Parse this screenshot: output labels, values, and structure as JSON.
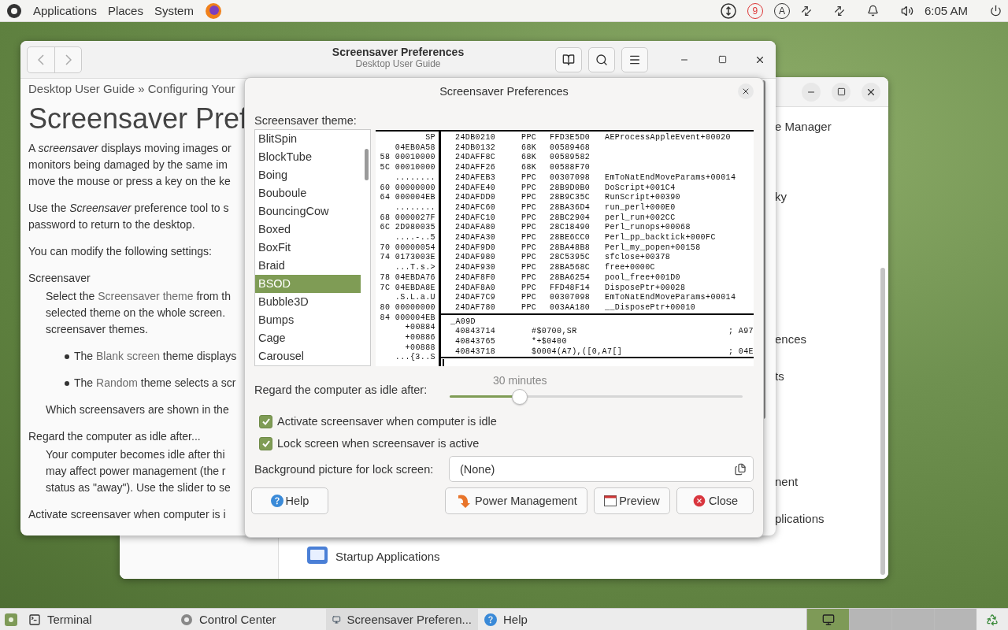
{
  "top_panel": {
    "menus": [
      "Applications",
      "Places",
      "System"
    ],
    "indicator_letter": "A",
    "badge": "9",
    "clock": "6:05 AM"
  },
  "control_center": {
    "sections": [
      [
        "e Manager"
      ],
      [
        "ky"
      ],
      [
        "ences",
        "ts"
      ],
      [
        "nent",
        "plications"
      ]
    ],
    "startup_item": "Startup Applications"
  },
  "help_window": {
    "title": "Screensaver Preferences",
    "subtitle": "Desktop User Guide",
    "breadcrumb": "Desktop User Guide » Configuring Your",
    "heading": "Screensaver Pref",
    "blocks": [
      {
        "kind": "para",
        "lines": [
          [
            {
              "text": "A *screensaver* displays moving images or"
            }
          ],
          [
            {
              "text": "monitors being damaged by the same im"
            }
          ],
          [
            {
              "text": "move the mouse or press a key on the ke"
            }
          ]
        ]
      },
      {
        "kind": "para",
        "lines": [
          [
            {
              "text": "Use the *Screensaver* preference tool to s"
            }
          ],
          [
            {
              "text": "password to return to the desktop."
            }
          ]
        ]
      },
      {
        "kind": "para",
        "lines": [
          [
            {
              "text": "You can modify the following settings:"
            }
          ]
        ]
      },
      {
        "kind": "term",
        "lines": [
          [
            {
              "text": "Screensaver"
            }
          ]
        ]
      },
      {
        "kind": "def",
        "lines": [
          [
            {
              "text": "Select the "
            },
            {
              "text": "Screensaver theme",
              "kind": "link"
            },
            {
              "text": " from th"
            }
          ],
          [
            {
              "text": "selected theme on the whole screen."
            }
          ],
          [
            {
              "text": "screensaver themes."
            }
          ]
        ]
      },
      {
        "kind": "bullet",
        "lines": [
          [
            {
              "text": "The "
            },
            {
              "text": "Blank screen",
              "kind": "link"
            },
            {
              "text": " theme displays"
            }
          ]
        ]
      },
      {
        "kind": "bullet",
        "lines": [
          [
            {
              "text": "The "
            },
            {
              "text": "Random",
              "kind": "link"
            },
            {
              "text": " theme selects a scr"
            }
          ]
        ]
      },
      {
        "kind": "def",
        "lines": [
          [
            {
              "text": "Which screensavers are shown in the"
            }
          ]
        ]
      },
      {
        "kind": "term",
        "lines": [
          [
            {
              "text": "Regard the computer as idle after..."
            }
          ]
        ]
      },
      {
        "kind": "def",
        "lines": [
          [
            {
              "text": "Your computer becomes idle after thi"
            }
          ],
          [
            {
              "text": "may affect power management (the r"
            }
          ],
          [
            {
              "text": "status as \"away\"). Use the slider to se"
            }
          ]
        ]
      },
      {
        "kind": "term",
        "lines": [
          [
            {
              "text": "Activate screensaver when computer is i"
            }
          ]
        ]
      }
    ]
  },
  "dialog": {
    "title": "Screensaver Preferences",
    "theme_label": "Screensaver theme:",
    "themes": [
      {
        "label": "BlitSpin",
        "selected": false
      },
      {
        "label": "BlockTube",
        "selected": false
      },
      {
        "label": "Boing",
        "selected": false
      },
      {
        "label": "Bouboule",
        "selected": false
      },
      {
        "label": "BouncingCow",
        "selected": false
      },
      {
        "label": "Boxed",
        "selected": false
      },
      {
        "label": "BoxFit",
        "selected": false
      },
      {
        "label": "Braid",
        "selected": false
      },
      {
        "label": "BSOD",
        "selected": true
      },
      {
        "label": "Bubble3D",
        "selected": false
      },
      {
        "label": "Bumps",
        "selected": false
      },
      {
        "label": "Cage",
        "selected": false
      },
      {
        "label": "Carousel",
        "selected": false
      }
    ],
    "preview": {
      "stack_lines": [
        "SP",
        "04EB0A58",
        "58 00010000",
        "5C 00010000",
        "........",
        "60 00000000",
        "64 000004EB",
        "........",
        "68 0000027F",
        "6C 2D980035",
        "....-..5",
        "70 00000054",
        "74 0173003E",
        "...T.s.>",
        "78 04EBDA76",
        "7C 04EBDA8E",
        ".S.L.a.U",
        "80 00000000",
        "84 000004EB",
        "+00884",
        "+00886",
        "+00888",
        "...{3..S"
      ],
      "trace_rows": [
        [
          "24DB0210",
          "PPC",
          "FFD3E5D0",
          "AEProcessAppleEvent+00020"
        ],
        [
          "24DB0132",
          "68K",
          "00589468"
        ],
        [
          "24DAFF8C",
          "68K",
          "00589582"
        ],
        [
          "24DAFF26",
          "68K",
          "00588F70"
        ],
        [
          "24DAFEB3",
          "PPC",
          "00307098",
          "EmToNatEndMoveParams+00014"
        ],
        [
          "24DAFE40",
          "PPC",
          "28B9D0B0",
          "DoScript+001C4"
        ],
        [
          "24DAFDD0",
          "PPC",
          "28B9C35C",
          "RunScript+00390"
        ],
        [
          "24DAFC60",
          "PPC",
          "28BA36D4",
          "run_perl+000E0"
        ],
        [
          "24DAFC10",
          "PPC",
          "28BC2904",
          "perl_run+002CC"
        ],
        [
          "24DAFA80",
          "PPC",
          "28C18490",
          "Perl_runops+00068"
        ],
        [
          "24DAFA30",
          "PPC",
          "28BE6CC0",
          "Perl_pp_backtick+000FC"
        ],
        [
          "24DAF9D0",
          "PPC",
          "28BA48B8",
          "Perl_my_popen+00158"
        ],
        [
          "24DAF980",
          "PPC",
          "28C5395C",
          "sfclose+00378"
        ],
        [
          "24DAF930",
          "PPC",
          "28BA568C",
          "free+0000C"
        ],
        [
          "24DAF8F0",
          "PPC",
          "28BA6254",
          "pool_free+001D0"
        ],
        [
          "24DAF8A0",
          "PPC",
          "FFD48F14",
          "DisposePtr+00028"
        ],
        [
          "24DAF7C9",
          "PPC",
          "00307098",
          "EmToNatEndMoveParams+00014"
        ],
        [
          "24DAF780",
          "PPC",
          "003AA180",
          "__DisposePtr+00010"
        ]
      ],
      "disasm_label": "_A09D",
      "disasm_rows": [
        [
          "40843714",
          "#$0700,SR",
          "; A97"
        ],
        [
          "40843765",
          "*+$0400"
        ],
        [
          "40843718",
          "$0004(A7),([0,A7[]",
          "; 04E"
        ]
      ]
    },
    "idle_label": "Regard the computer as idle after:",
    "idle_slider": {
      "reading": "30 minutes",
      "level": 0.24
    },
    "options": [
      {
        "label": "Activate screensaver when computer is idle",
        "checked": true
      },
      {
        "label": "Lock screen when screensaver is active",
        "checked": true
      }
    ],
    "background_label": "Background picture for lock screen:",
    "background_value": "(None)",
    "buttons": {
      "help": "Help",
      "power": "Power Management",
      "preview": "Preview",
      "close": "Close"
    }
  },
  "taskbar": {
    "tasks": [
      {
        "kind": "terminal",
        "label": "Terminal",
        "selected": false
      },
      {
        "kind": "control",
        "label": "Control Center",
        "selected": false
      },
      {
        "kind": "screensaver",
        "label": "Screensaver Preferen...",
        "selected": true
      },
      {
        "kind": "help",
        "label": "Help",
        "selected": false
      }
    ],
    "workspaces": [
      {
        "selected": true
      },
      {
        "selected": false
      },
      {
        "selected": false
      },
      {
        "selected": false
      }
    ]
  }
}
